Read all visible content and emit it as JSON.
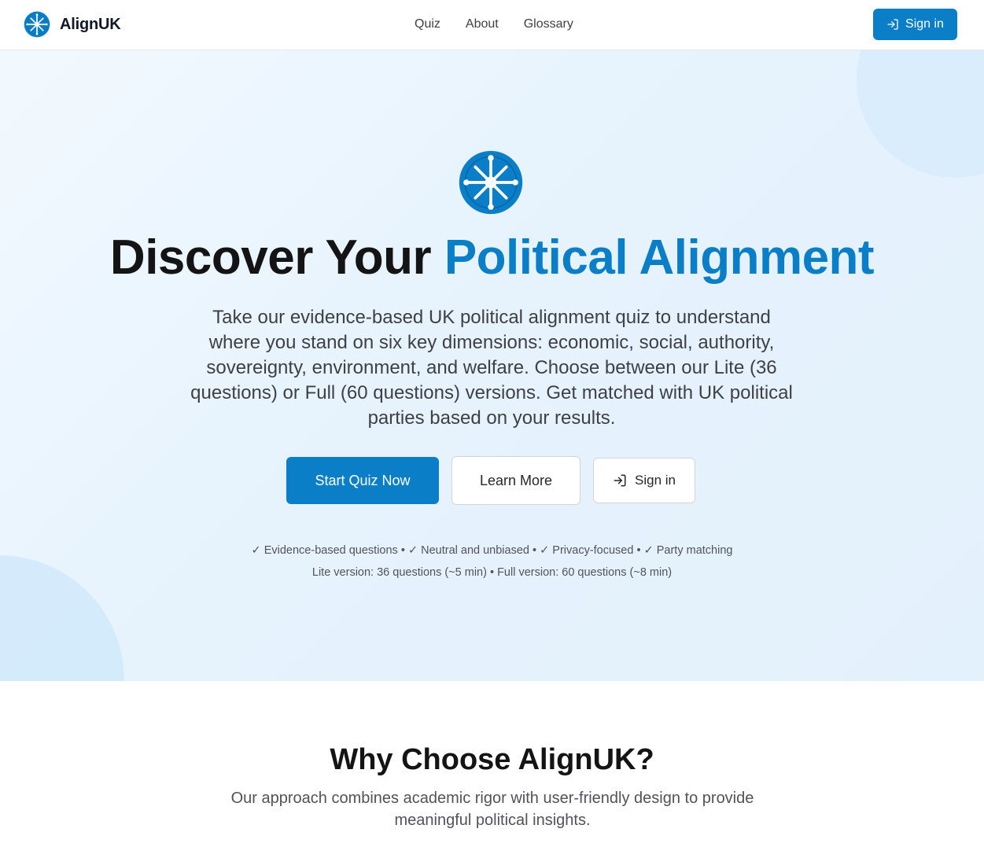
{
  "header": {
    "brand": "AlignUK",
    "nav": [
      "Quiz",
      "About",
      "Glossary"
    ],
    "sign_in_label": "Sign in"
  },
  "hero": {
    "title_plain": "Discover Your ",
    "title_accent": "Political Alignment",
    "description": "Take our evidence-based UK political alignment quiz to understand where you stand on six key dimensions: economic, social, authority, sovereignty, environment, and welfare. Choose between our Lite (36 questions) or Full (60 questions) versions. Get matched with UK political parties based on your results.",
    "primary_button": "Start Quiz Now",
    "secondary_button": "Learn More",
    "signin_button": "Sign in",
    "features": "✓ Evidence-based questions • ✓ Neutral and unbiased • ✓ Privacy-focused • ✓ Party matching",
    "versions": "Lite version: 36 questions (~5 min) • Full version: 60 questions (~8 min)"
  },
  "why": {
    "title": "Why Choose AlignUK?",
    "description": "Our approach combines academic rigor with user-friendly design to provide meaningful political insights."
  },
  "icons": {
    "logo": "compass-logo-icon",
    "sign_in": "sign-in-arrow-icon"
  },
  "colors": {
    "accent": "#0a7fc7",
    "hero_background": "#e6f3fd"
  }
}
